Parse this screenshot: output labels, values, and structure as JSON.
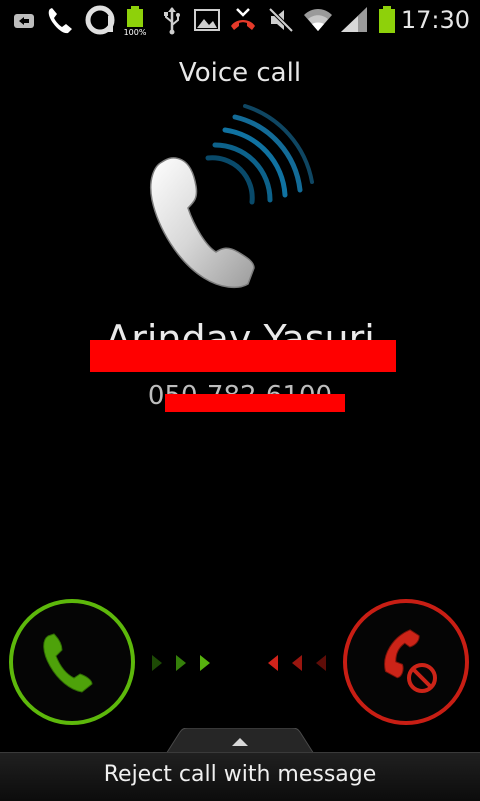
{
  "status_bar": {
    "icons": [
      "notification-icon",
      "call-icon",
      "app-icon",
      "battery-100-icon",
      "usb-icon",
      "image-icon",
      "missed-call-icon",
      "mute-icon",
      "wifi-icon",
      "signal-icon",
      "battery-icon"
    ],
    "battery_small_label": "100%",
    "time": "17:30"
  },
  "call": {
    "title": "Voice call",
    "caller_name": "Arinday Yasuri",
    "caller_number": "050-782-6100",
    "redaction_color": "#ff0000"
  },
  "actions": {
    "accept_color": "#5db80b",
    "reject_color": "#c81e14",
    "reject_with_message_label": "Reject call with message"
  }
}
